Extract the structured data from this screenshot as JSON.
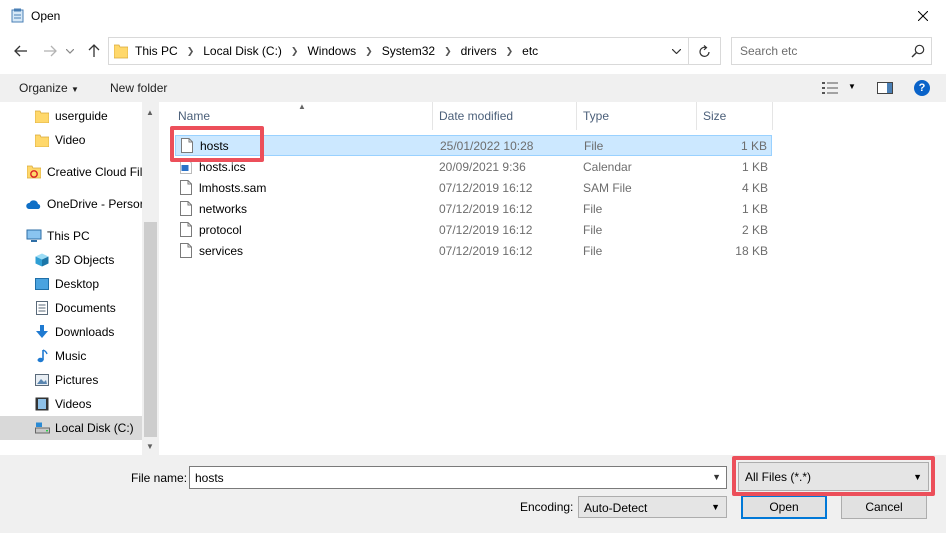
{
  "window": {
    "title": "Open"
  },
  "address": {
    "crumbs": [
      "This PC",
      "Local Disk (C:)",
      "Windows",
      "System32",
      "drivers",
      "etc"
    ]
  },
  "search": {
    "placeholder": "Search etc"
  },
  "toolbar": {
    "organize": "Organize",
    "new_folder": "New folder",
    "help": "?"
  },
  "nav": {
    "items": [
      {
        "label": "userguide",
        "icon": "folder-icon"
      },
      {
        "label": "Video",
        "icon": "folder-icon"
      },
      {
        "label": "Creative Cloud Fil",
        "icon": "creative-cloud-icon"
      },
      {
        "label": "OneDrive - Persor",
        "icon": "onedrive-icon"
      },
      {
        "label": "This PC",
        "icon": "pc-icon"
      },
      {
        "label": "3D Objects",
        "icon": "3d-objects-icon"
      },
      {
        "label": "Desktop",
        "icon": "desktop-icon"
      },
      {
        "label": "Documents",
        "icon": "documents-icon"
      },
      {
        "label": "Downloads",
        "icon": "downloads-icon"
      },
      {
        "label": "Music",
        "icon": "music-icon"
      },
      {
        "label": "Pictures",
        "icon": "pictures-icon"
      },
      {
        "label": "Videos",
        "icon": "videos-icon"
      },
      {
        "label": "Local Disk (C:)",
        "icon": "drive-icon"
      }
    ]
  },
  "columns": {
    "name": "Name",
    "date": "Date modified",
    "type": "Type",
    "size": "Size"
  },
  "files": [
    {
      "name": "hosts",
      "date": "25/01/2022 10:28",
      "type": "File",
      "size": "1 KB",
      "icon": "file-icon"
    },
    {
      "name": "hosts.ics",
      "date": "20/09/2021 9:36",
      "type": "Calendar",
      "size": "1 KB",
      "icon": "calendar-file-icon"
    },
    {
      "name": "lmhosts.sam",
      "date": "07/12/2019 16:12",
      "type": "SAM File",
      "size": "4 KB",
      "icon": "file-icon"
    },
    {
      "name": "networks",
      "date": "07/12/2019 16:12",
      "type": "File",
      "size": "1 KB",
      "icon": "file-icon"
    },
    {
      "name": "protocol",
      "date": "07/12/2019 16:12",
      "type": "File",
      "size": "2 KB",
      "icon": "file-icon"
    },
    {
      "name": "services",
      "date": "07/12/2019 16:12",
      "type": "File",
      "size": "18 KB",
      "icon": "file-icon"
    }
  ],
  "bottom": {
    "filename_label": "File name:",
    "filename_value": "hosts",
    "filter_value": "All Files  (*.*)",
    "encoding_label": "Encoding:",
    "encoding_value": "Auto-Detect",
    "open_label": "Open",
    "cancel_label": "Cancel"
  },
  "colors": {
    "accent": "#0078d7",
    "selection": "#cce8ff",
    "highlight": "#ec4f5a"
  }
}
